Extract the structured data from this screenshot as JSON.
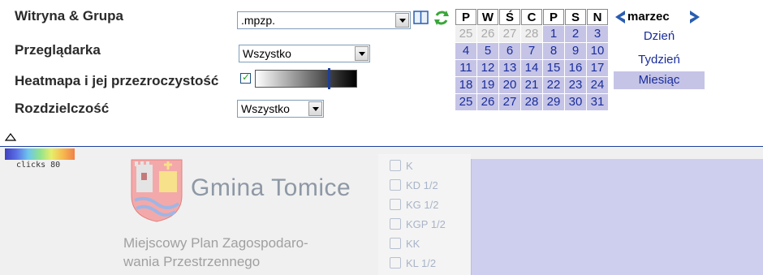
{
  "form": {
    "site_label": "Witryna & Grupa",
    "site_value": ".mpzp.",
    "browser_label": "Przeglądarka",
    "browser_value": "Wszystko",
    "heatmap_label": "Heatmapa i jej przezroczystość",
    "resolution_label": "Rozdzielczość",
    "resolution_value": "Wszystko"
  },
  "calendar": {
    "headers": [
      "P",
      "W",
      "Ś",
      "C",
      "P",
      "S",
      "N"
    ],
    "weeks": [
      [
        "25",
        "26",
        "27",
        "28",
        "1",
        "2",
        "3"
      ],
      [
        "4",
        "5",
        "6",
        "7",
        "8",
        "9",
        "10"
      ],
      [
        "11",
        "12",
        "13",
        "14",
        "15",
        "16",
        "17"
      ],
      [
        "18",
        "19",
        "20",
        "21",
        "22",
        "23",
        "24"
      ],
      [
        "25",
        "26",
        "27",
        "28",
        "29",
        "30",
        "31"
      ]
    ],
    "month": "marzec",
    "periods": [
      "Dzień",
      "Tydzień",
      "Miesiąc"
    ],
    "active_period": "Miesiąc"
  },
  "heatmap_legend": {
    "label": "clicks  80"
  },
  "preview": {
    "logo_title": "Gmina Tomice",
    "plan_line1": "Miejscowy Plan Zagospodaro-",
    "plan_line2": "wania Przestrzennego",
    "layers": [
      "K",
      "KD 1/2",
      "KG 1/2",
      "KGP 1/2",
      "KK",
      "KL 1/2"
    ]
  },
  "colors": {
    "accent": "#1a2d9c",
    "calendar_bg": "#c5c4e6",
    "divider": "#1c3f9c"
  }
}
